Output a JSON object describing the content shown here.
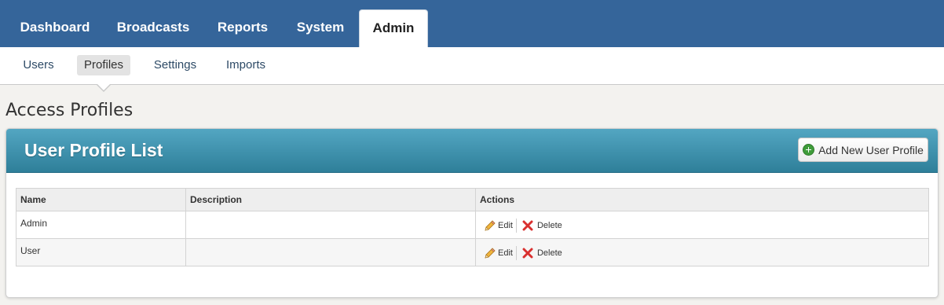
{
  "topnav": {
    "tabs": [
      {
        "label": "Dashboard"
      },
      {
        "label": "Broadcasts"
      },
      {
        "label": "Reports"
      },
      {
        "label": "System"
      },
      {
        "label": "Admin"
      }
    ],
    "active": "Admin"
  },
  "subnav": {
    "items": [
      {
        "label": "Users"
      },
      {
        "label": "Profiles"
      },
      {
        "label": "Settings"
      },
      {
        "label": "Imports"
      }
    ],
    "active": "Profiles"
  },
  "page": {
    "title": "Access Profiles"
  },
  "panel": {
    "title": "User Profile List",
    "add_button_label": "Add New User Profile"
  },
  "table": {
    "columns": [
      "Name",
      "Description",
      "Actions"
    ],
    "rows": [
      {
        "name": "Admin",
        "description": "",
        "edit": "Edit",
        "delete": "Delete"
      },
      {
        "name": "User",
        "description": "",
        "edit": "Edit",
        "delete": "Delete"
      }
    ]
  },
  "colors": {
    "topnav": "#35659a",
    "panel_header": "#3f93af",
    "add_icon": "#3f9c3a",
    "delete_icon": "#d9302f"
  },
  "icons": [
    "plus-circle-icon",
    "pencil-icon",
    "delete-x-icon"
  ]
}
